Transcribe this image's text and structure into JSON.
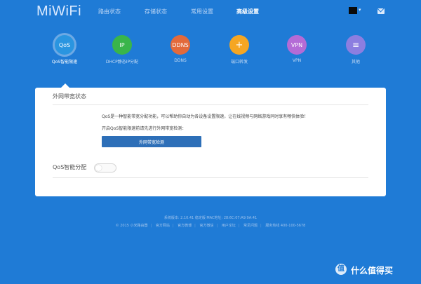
{
  "brand": {
    "logo": "MiWiFi"
  },
  "nav": {
    "tabs": [
      {
        "label": "路由状态"
      },
      {
        "label": "存储状态"
      },
      {
        "label": "常用设置"
      },
      {
        "label": "高级设置"
      }
    ],
    "active_index": 3,
    "user_caret": "▾"
  },
  "tools": [
    {
      "icon_text": "QoS",
      "label": "QoS智能限速",
      "color": "#2a95e0",
      "icon": "qos-icon"
    },
    {
      "icon_text": "IP",
      "label": "DHCP静态IP分配",
      "color": "#39b54a",
      "icon": "ip-icon"
    },
    {
      "icon_text": "DDNS",
      "label": "DDNS",
      "color": "#e36a3b",
      "icon": "ddns-icon"
    },
    {
      "icon_text": "+",
      "label": "端口转发",
      "color": "#f5a623",
      "icon": "port-forward-icon"
    },
    {
      "icon_text": "VPN",
      "label": "VPN",
      "color": "#b46bd6",
      "icon": "vpn-icon"
    },
    {
      "icon_text": "≡",
      "label": "其他",
      "color": "#8c7ee0",
      "icon": "menu-icon"
    }
  ],
  "card": {
    "title": "外网带宽状态",
    "desc": "QoS是一种智能带宽分配功能，可以帮助你自动为各设备设置限速，让在线视频与网络游戏同时享有畅快体验！",
    "desc2": "开启QoS智能限速前请先进行外网带宽检测：",
    "button": "外网带宽检测",
    "toggle_label": "QoS智能分配",
    "toggle_on": false
  },
  "footer": {
    "line1": "系统版本: 2.10.41 稳定版  MAC地址: 28:6C:07:A9:9A:41",
    "links": [
      "© 2015 小米路由器",
      "官方网站",
      "官方微博",
      "官方微信",
      "用户论坛",
      "常见问题",
      "服务热线 400-100-5678"
    ]
  },
  "watermark": {
    "icon_text": "值",
    "text": "什么值得买"
  }
}
